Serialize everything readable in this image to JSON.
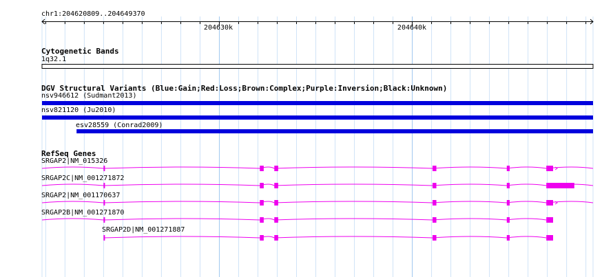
{
  "ruler": {
    "location": "chr1:204620809..204649370",
    "start": 204620809,
    "end": 204649370,
    "ticks": [
      {
        "label": "204630k",
        "pos": 204630000
      },
      {
        "label": "204640k",
        "pos": 204640000
      }
    ]
  },
  "tracks": {
    "cytoband": {
      "title": "Cytogenetic Bands",
      "band": "1q32.1"
    },
    "dgv": {
      "title": "DGV Structural Variants (Blue:Gain;Red:Loss;Brown:Complex;Purple:Inversion;Black:Unknown)",
      "color": "#0000dd",
      "features": [
        {
          "label": "nsv946612 (Sudmant2013)",
          "start": 204620809,
          "end": 204649370
        },
        {
          "label": "nsv821120 (Ju2010)",
          "start": 204620809,
          "end": 204649370
        },
        {
          "label": "esv28559 (Conrad2009)",
          "start": 204622600,
          "end": 204649370
        }
      ]
    },
    "refseq": {
      "title": "RefSeq Genes",
      "color": "#ee00ee",
      "genes": [
        {
          "label": "SRGAP2|NM_015326",
          "start": 204620809,
          "end": 204649370,
          "strand": "+"
        },
        {
          "label": "SRGAP2C|NM_001271872",
          "start": 204620809,
          "end": 204649370,
          "strand": "+",
          "utr": [
            204647100,
            204648400
          ]
        },
        {
          "label": "SRGAP2|NM_001170637",
          "start": 204620809,
          "end": 204649370,
          "strand": "+"
        },
        {
          "label": "SRGAP2B|NM_001271870",
          "start": 204620809,
          "end": 204647300,
          "strand": "+"
        },
        {
          "label": "SRGAP2D|NM_001271887",
          "start": 204624000,
          "end": 204647300,
          "strand": "+"
        }
      ],
      "exons": [
        {
          "start": 204624000,
          "end": 204624060
        },
        {
          "start": 204632100,
          "end": 204632300
        },
        {
          "start": 204632850,
          "end": 204633050
        },
        {
          "start": 204641050,
          "end": 204641250
        },
        {
          "start": 204644900,
          "end": 204645050
        },
        {
          "start": 204646950,
          "end": 204647300
        }
      ]
    }
  }
}
